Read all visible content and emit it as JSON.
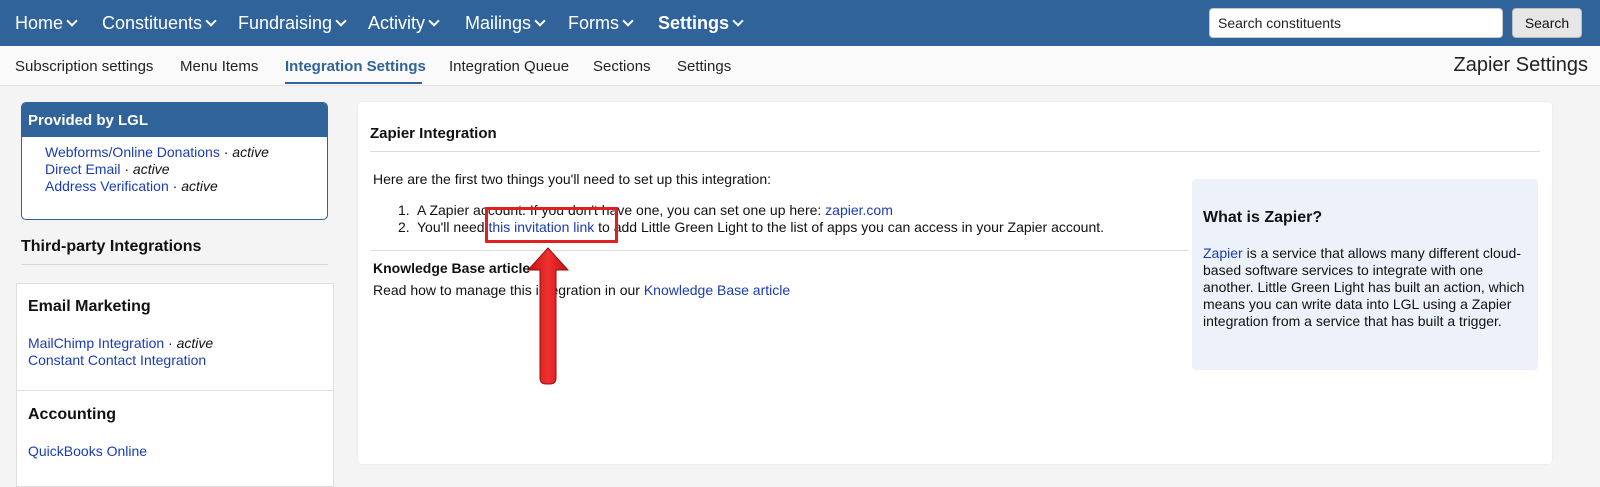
{
  "topnav": {
    "items": [
      {
        "label": "Home",
        "bold": false
      },
      {
        "label": "Constituents",
        "bold": false
      },
      {
        "label": "Fundraising",
        "bold": false
      },
      {
        "label": "Activity",
        "bold": false
      },
      {
        "label": "Mailings",
        "bold": false
      },
      {
        "label": "Forms",
        "bold": false
      },
      {
        "label": "Settings",
        "bold": true
      }
    ],
    "search_placeholder": "Search constituents",
    "search_button": "Search"
  },
  "subnav": {
    "items": [
      {
        "label": "Subscription settings"
      },
      {
        "label": "Menu Items"
      },
      {
        "label": "Integration Settings"
      },
      {
        "label": "Integration Queue"
      },
      {
        "label": "Sections"
      },
      {
        "label": "Settings"
      }
    ],
    "page_name": "Zapier Settings"
  },
  "provided": {
    "title": "Provided by LGL",
    "items": [
      {
        "label": "Webforms/Online Donations",
        "status": "active"
      },
      {
        "label": "Direct Email",
        "status": "active"
      },
      {
        "label": "Address Verification",
        "status": "active"
      }
    ]
  },
  "third_party": {
    "title": "Third-party Integrations",
    "email": {
      "title": "Email Marketing",
      "items": [
        {
          "label": "MailChimp Integration",
          "status": "active"
        },
        {
          "label": "Constant Contact Integration"
        }
      ]
    },
    "accounting": {
      "title": "Accounting",
      "items": [
        {
          "label": "QuickBooks Online"
        }
      ]
    }
  },
  "main": {
    "title": "Zapier Integration",
    "intro": "Here are the first two things you'll need to set up this integration:",
    "step1": {
      "num": "1.",
      "text": "A Zapier account. If you don't have one, you can set one up here:",
      "link": "zapier.com"
    },
    "step2": {
      "num": "2.",
      "pre": "You'll need",
      "link": "this invitation link",
      "post": "to add Little Green Light to the list of apps you can access in your Zapier account."
    },
    "kb_title": "Knowledge Base article",
    "kb_text": "Read how to manage this integration in our",
    "kb_link": "Knowledge Base article"
  },
  "zapier_box": {
    "title": "What is Zapier?",
    "link": "Zapier",
    "text": "is a service that allows many different cloud-based software services to integrate with one another. Little Green Light has built an action, which means you can write data into LGL using a Zapier integration from a service that has built a trigger."
  },
  "colors": {
    "brand": "#2f6399",
    "link": "#1a3cb3",
    "annotation": "#e02020",
    "info_bg": "#edf2fa"
  }
}
